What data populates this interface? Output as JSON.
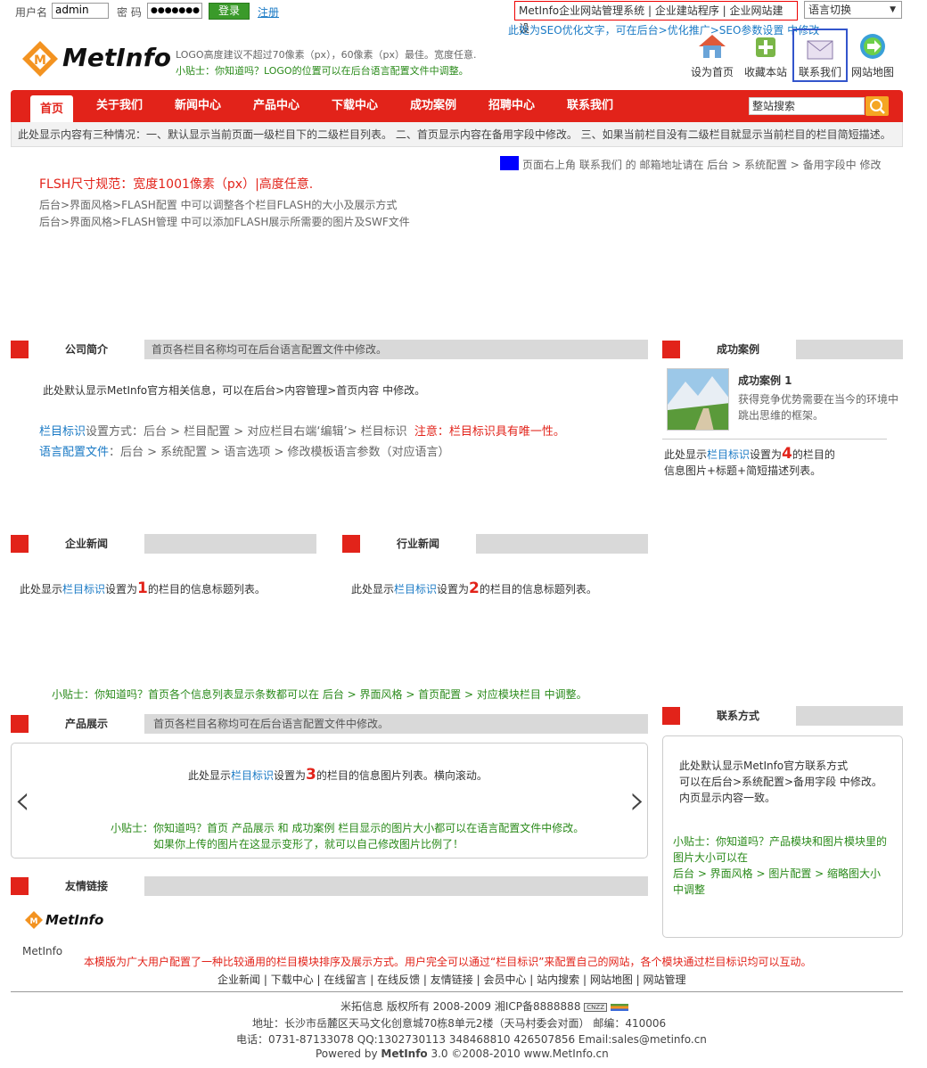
{
  "top": {
    "username_label": "用户名",
    "username_value": "admin",
    "password_label": "密 码",
    "password_value": "●●●●●●●",
    "login_button": "登录",
    "register_link": "注册",
    "cms_links": "MetInfo企业网站管理系统 | 企业建站程序 | 企业网站建设",
    "lang_switch": "语言切换",
    "seo_note": "此处为SEO优化文字，可在后台>优化推广>SEO参数设置 中修改"
  },
  "logo": {
    "text": "MetInfo",
    "note1": "LOGO高度建议不超过70像素（px），60像素（px）最佳。宽度任意.",
    "note2": "小贴士：你知道吗？LOGO的位置可以在后台语言配置文件中调整。"
  },
  "quick": [
    {
      "label": "设为首页",
      "icon": "home-icon"
    },
    {
      "label": "收藏本站",
      "icon": "bookmark-add-icon"
    },
    {
      "label": "联系我们",
      "icon": "envelope-icon"
    },
    {
      "label": "网站地图",
      "icon": "arrow-globe-icon"
    }
  ],
  "nav": {
    "items": [
      "首页",
      "关于我们",
      "新闻中心",
      "产品中心",
      "下载中心",
      "成功案例",
      "招聘中心",
      "联系我们"
    ],
    "search_placeholder": "整站搜索",
    "subnote": "此处显示内容有三种情况：一、默认显示当前页面一级栏目下的二级栏目列表。 二、首页显示内容在备用字段中修改。 三、如果当前栏目没有二级栏目就显示当前栏目的栏目简短描述。"
  },
  "email_note": "页面右上角 联系我们 的 邮箱地址请在 后台 > 系统配置 > 备用字段中 修改",
  "flash": {
    "title": "FLSH尺寸规范：宽度1001像素（px）|高度任意.",
    "line1": "后台>界面风格>FLASH配置 中可以调整各个栏目FLASH的大小及展示方式",
    "line2": "后台>界面风格>FLASH管理 中可以添加FLASH展示所需要的图片及SWF文件"
  },
  "about": {
    "title": "公司简介",
    "bar_text": "首页各栏目名称均可在后台语言配置文件中修改。",
    "body": "此处默认显示MetInfo官方相关信息，可以在后台>内容管理>首页内容 中修改。",
    "tag_label": "栏目标识",
    "tag_text": "设置方式：后台 > 栏目配置 > 对应栏目右端‘编辑’> 栏目标识",
    "tag_warn": "注意：栏目标识具有唯一性。",
    "lang_label": "语言配置文件",
    "lang_text": "：后台 > 系统配置 > 语言选项 > 修改模板语言参数（对应语言）"
  },
  "cases": {
    "title": "成功案例",
    "item_title": "成功案例 1",
    "item_desc": "获得竞争优势需要在当今的环境中跳出思维的框架。",
    "note_a": "此处显示",
    "note_tag": "栏目标识",
    "note_b": "设置为",
    "note_num": "4",
    "note_c": "的栏目的",
    "note_d": "信息图片+标题+简短描述列表。"
  },
  "news1": {
    "title": "企业新闻",
    "a": "此处显示",
    "tag": "栏目标识",
    "b": "设置为",
    "num": "1",
    "c": "的栏目的信息标题列表。"
  },
  "news2": {
    "title": "行业新闻",
    "a": "此处显示",
    "tag": "栏目标识",
    "b": "设置为",
    "num": "2",
    "c": "的栏目的信息标题列表。"
  },
  "tip_home": "小贴士：你知道吗？首页各个信息列表显示条数都可以在 后台 > 界面风格 > 首页配置 > 对应模块栏目 中调整。",
  "products": {
    "title": "产品展示",
    "bar_text": "首页各栏目名称均可在后台语言配置文件中修改。",
    "a": "此处显示",
    "tag": "栏目标识",
    "b": "设置为",
    "num": "3",
    "c": "的栏目的信息图片列表。横向滚动。",
    "tip1": "小贴士：你知道吗？首页 产品展示 和 成功案例 栏目显示的图片大小都可以在语言配置文件中修改。",
    "tip2": "如果你上传的图片在这显示变形了，就可以自己修改图片比例了！",
    "prev": "‹",
    "next": "›"
  },
  "contact": {
    "title": "联系方式",
    "l1": "此处默认显示MetInfo官方联系方式",
    "l2": "可以在后台>系统配置>备用字段 中修改。",
    "l3": "内页显示内容一致。",
    "t1": "小贴士：你知道吗？产品模块和图片模块里的",
    "t2": "图片大小可以在",
    "t3": "后台 > 界面风格 > 图片配置 > 缩略图大小",
    "t4": "中调整"
  },
  "links": {
    "title": "友情链接",
    "logo_text": "MetInfo",
    "caption": "MetInfo"
  },
  "footer": {
    "note": "本模版为广大用户配置了一种比较通用的栏目模块排序及展示方式。用户完全可以通过“栏目标识”来配置自己的网站，各个模块通过栏目标识均可以互动。",
    "links": [
      "企业新闻",
      "下载中心",
      "在线留言",
      "在线反馈",
      "友情链接",
      "会员中心",
      "站内搜索",
      "网站地图",
      "网站管理"
    ],
    "copyright": "米拓信息 版权所有 2008-2009 湘ICP备8888888",
    "cnzz": "CNZZ",
    "address": "地址：长沙市岳麓区天马文化创意城70栋8单元2楼（天马村委会对面） 邮编：410006",
    "phone": "电话：0731-87133078 QQ:1302730113 348468810 426507856 Email:sales@metinfo.cn",
    "powered_a": "Powered by ",
    "powered_b": "MetInfo",
    "powered_c": " 3.0 ©2008-2010 www.MetInfo.cn"
  },
  "colors": {
    "accent": "#e2231a",
    "link": "#1a7ac5",
    "tip": "#2a8a1a"
  }
}
